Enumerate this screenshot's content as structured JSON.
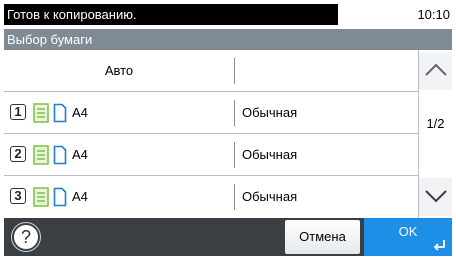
{
  "status": {
    "message": "Готов к копированию.",
    "time": "10:10"
  },
  "title": "Выбор бумаги",
  "auto_row": {
    "label": "Авто",
    "type": ""
  },
  "trays": [
    {
      "number": "1",
      "size": "A4",
      "type": "Обычная",
      "paper_icon": "paper-stack-icon",
      "doc_icon": "document-portrait-icon"
    },
    {
      "number": "2",
      "size": "A4",
      "type": "Обычная",
      "paper_icon": "paper-stack-icon",
      "doc_icon": "document-portrait-icon"
    },
    {
      "number": "3",
      "size": "A4",
      "type": "Обычная",
      "paper_icon": "paper-stack-icon",
      "doc_icon": "document-portrait-icon"
    }
  ],
  "scroll": {
    "page": "1/2",
    "up_icon": "chevron-up-icon",
    "down_icon": "chevron-down-icon"
  },
  "bottom": {
    "help_icon": "help-icon",
    "help_glyph": "?",
    "cancel_label": "Отмена",
    "ok_label": "OK",
    "enter_icon": "enter-icon"
  },
  "colors": {
    "accent": "#1e8fe6",
    "title_bar": "#7f8a94",
    "bottom_bar": "#3a3f44",
    "paper_green": "#7cc23c",
    "doc_blue": "#1e7fd1"
  }
}
